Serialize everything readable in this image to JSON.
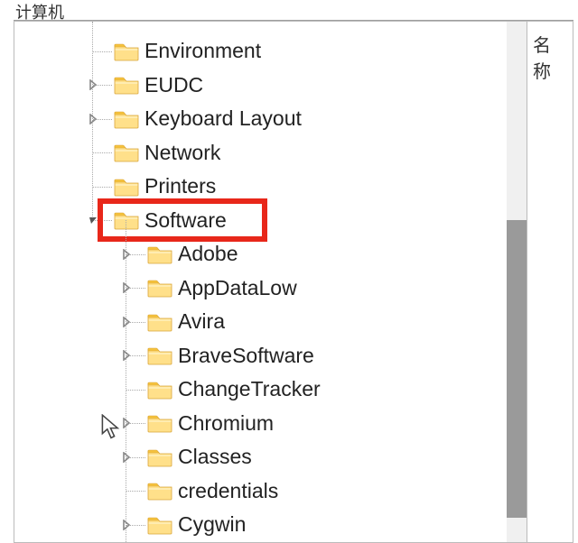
{
  "titlebar": {
    "text": "计算机"
  },
  "right_pane": {
    "header": "名称"
  },
  "tree": {
    "level1_indent": 110,
    "level2_indent": 147,
    "expander_offset_l1": 80,
    "expander_offset_l2": 117,
    "items_l1": [
      {
        "label": "Environment",
        "expandable": false
      },
      {
        "label": "EUDC",
        "expandable": true
      },
      {
        "label": "Keyboard Layout",
        "expandable": true
      },
      {
        "label": "Network",
        "expandable": false
      },
      {
        "label": "Printers",
        "expandable": false
      },
      {
        "label": "Software",
        "expandable": true,
        "expanded": true,
        "highlighted": true
      }
    ],
    "items_l2": [
      {
        "label": "Adobe",
        "expandable": true
      },
      {
        "label": "AppDataLow",
        "expandable": true
      },
      {
        "label": "Avira",
        "expandable": true
      },
      {
        "label": "BraveSoftware",
        "expandable": true
      },
      {
        "label": "ChangeTracker",
        "expandable": false
      },
      {
        "label": "Chromium",
        "expandable": true
      },
      {
        "label": "Classes",
        "expandable": true
      },
      {
        "label": "credentials",
        "expandable": false
      },
      {
        "label": "Cygwin",
        "expandable": true
      }
    ]
  },
  "icons": {
    "folder": "folder-icon",
    "expand_collapsed": "chevron-right-icon",
    "expand_expanded": "chevron-down-icon",
    "cursor": "cursor-icon"
  },
  "colors": {
    "highlight": "#e8271a",
    "folder_fill": "#ffd76b",
    "folder_tab": "#f5c23d"
  }
}
